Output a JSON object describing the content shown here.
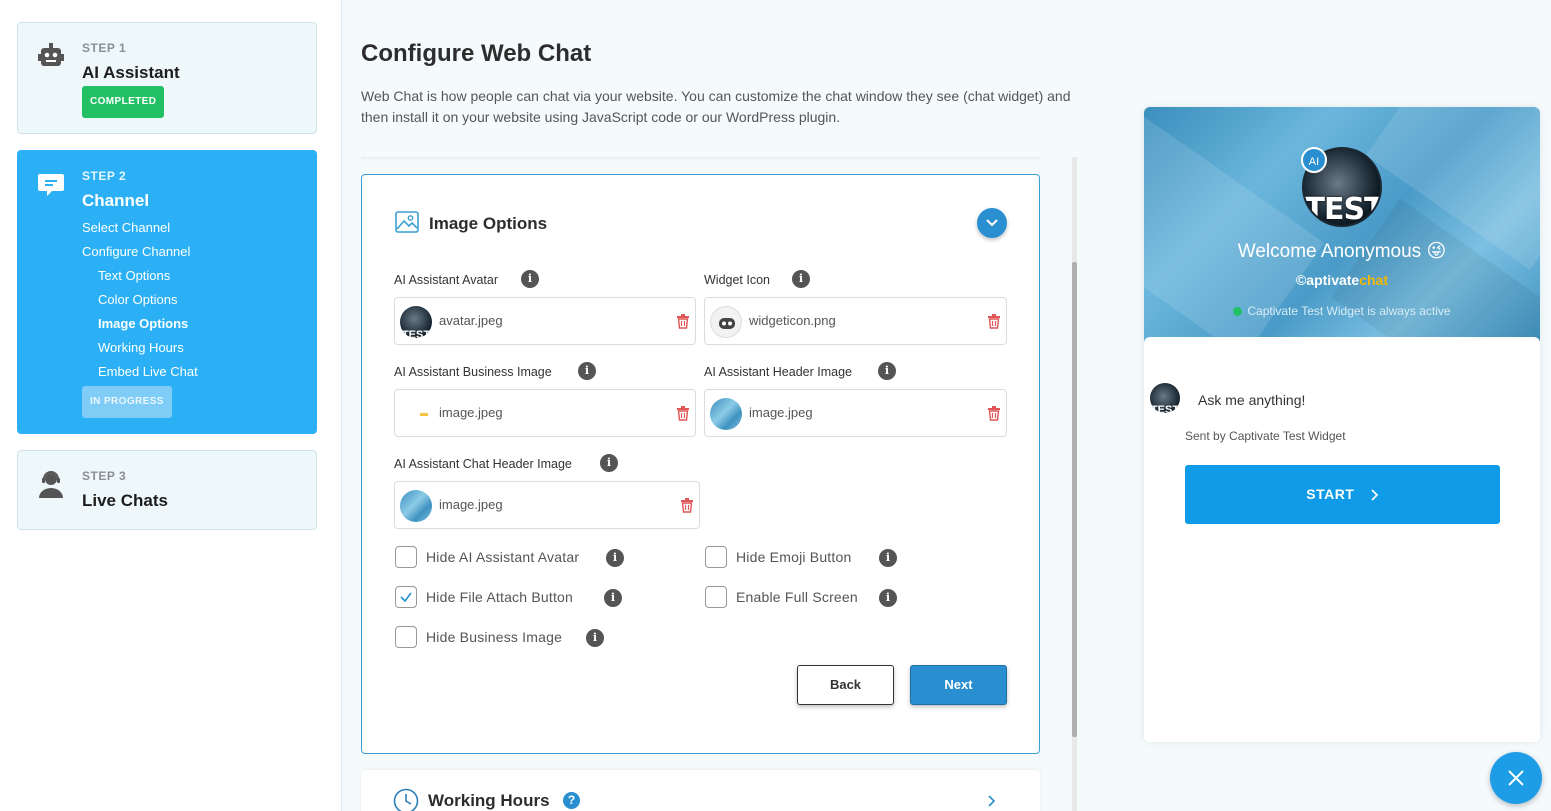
{
  "sidebar": {
    "steps": [
      {
        "kicker": "STEP 1",
        "title": "AI Assistant",
        "badge": "COMPLETED"
      },
      {
        "kicker": "STEP 2",
        "title": "Channel",
        "badge": "IN PROGRESS",
        "items": [
          "Select Channel",
          "Configure Channel",
          "Text Options",
          "Color Options",
          "Image Options",
          "Working Hours",
          "Embed Live Chat"
        ]
      },
      {
        "kicker": "STEP 3",
        "title": "Live Chats"
      }
    ]
  },
  "main": {
    "title": "Configure Web Chat",
    "description": "Web Chat is how people can chat via your website. You can customize the chat window they see (chat widget) and then install it on your website using JavaScript code or our WordPress plugin."
  },
  "image_options": {
    "title": "Image Options",
    "fields": [
      {
        "label": "AI Assistant Avatar",
        "file": "avatar.jpeg"
      },
      {
        "label": "Widget Icon",
        "file": "widgeticon.png"
      },
      {
        "label": "AI Assistant Business Image",
        "file": "image.jpeg"
      },
      {
        "label": "AI Assistant Header Image",
        "file": "image.jpeg"
      },
      {
        "label": "AI Assistant Chat Header Image",
        "file": "image.jpeg"
      }
    ],
    "checkboxes": [
      {
        "label": "Hide AI Assistant Avatar",
        "checked": false
      },
      {
        "label": "Hide Emoji Button",
        "checked": false
      },
      {
        "label": "Hide File Attach Button",
        "checked": true
      },
      {
        "label": "Enable Full Screen",
        "checked": false
      },
      {
        "label": "Hide Business Image",
        "checked": false
      }
    ],
    "back_label": "Back",
    "next_label": "Next",
    "info_glyph": "i"
  },
  "working_hours": {
    "title": "Working Hours"
  },
  "preview": {
    "ai_badge": "AI",
    "avatar_text": "TEST",
    "welcome": "Welcome Anonymous",
    "emoji": "😜",
    "brand_prefix": "©aptivate",
    "brand_suffix": "chat",
    "status": "Captivate Test Widget is always active",
    "message": "Ask me anything!",
    "sent_by": "Sent by Captivate Test Widget",
    "start_label": "START"
  },
  "colors": {
    "accent": "#2a8fd0",
    "step_active": "#2bb0f5",
    "completed": "#22c064",
    "start": "#0f9be8"
  }
}
